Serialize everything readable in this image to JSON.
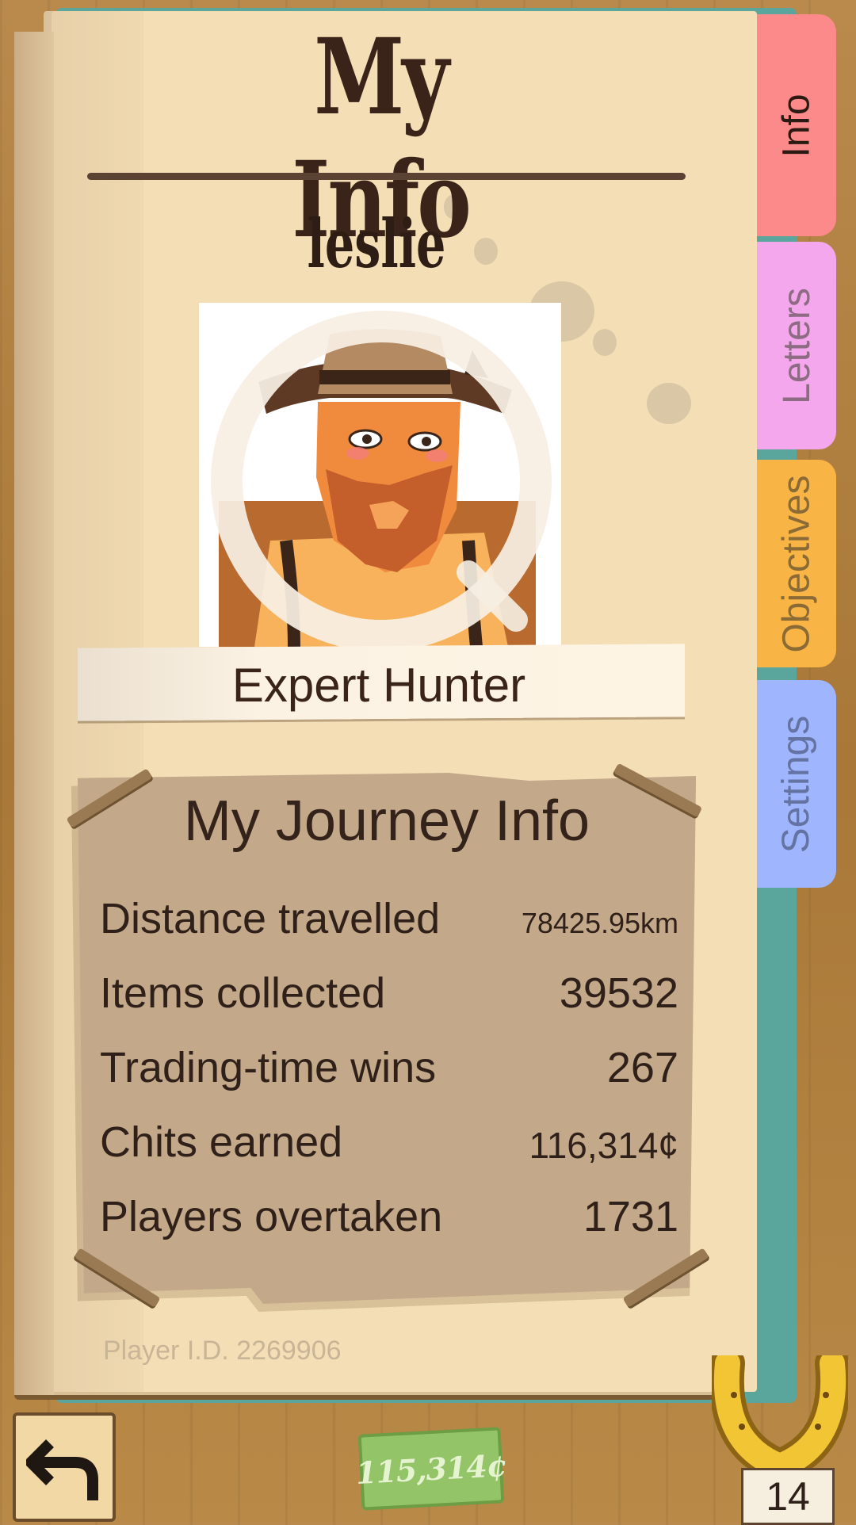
{
  "header": {
    "title": "My Info"
  },
  "profile": {
    "username": "leslie",
    "rank": "Expert Hunter",
    "player_id": "Player I.D. 2269906"
  },
  "tabs": [
    {
      "label": "Info",
      "color": "#fd8a8a",
      "active": true
    },
    {
      "label": "Letters",
      "color": "#f4a7ec",
      "active": false
    },
    {
      "label": "Objectives",
      "color": "#f8b445",
      "active": false
    },
    {
      "label": "Settings",
      "color": "#9fb6ff",
      "active": false
    }
  ],
  "journey": {
    "title": "My Journey Info",
    "stats": [
      {
        "label": "Distance travelled",
        "value": "78425.95km"
      },
      {
        "label": "Items collected",
        "value": "39532"
      },
      {
        "label": "Trading-time wins",
        "value": "267"
      },
      {
        "label": "Chits earned",
        "value": "116,314¢"
      },
      {
        "label": "Players overtaken",
        "value": "1731"
      }
    ]
  },
  "footer": {
    "back_icon": "back-arrow-icon",
    "money": "115,314¢",
    "horseshoe_icon": "horseshoe-icon",
    "horseshoe_count": "14"
  }
}
